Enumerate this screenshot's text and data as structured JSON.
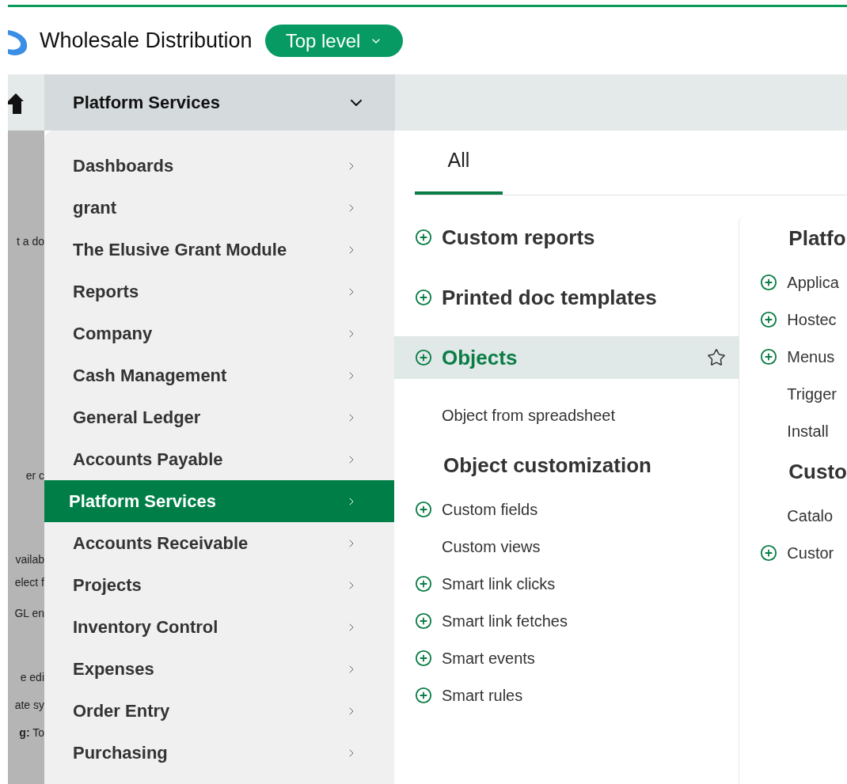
{
  "header": {
    "title": "Wholesale Distribution",
    "level_button": "Top level"
  },
  "nav": {
    "current": "Platform Services"
  },
  "background_fragments": [
    "t a do",
    "er c",
    "vailab",
    "elect f",
    "GL en",
    "e edi",
    "ate sy",
    "**g:** To"
  ],
  "menu": [
    {
      "label": "Dashboards",
      "selected": false
    },
    {
      "label": "grant",
      "selected": false
    },
    {
      "label": "The Elusive Grant Module",
      "selected": false
    },
    {
      "label": "Reports",
      "selected": false
    },
    {
      "label": "Company",
      "selected": false
    },
    {
      "label": "Cash Management",
      "selected": false
    },
    {
      "label": "General Ledger",
      "selected": false
    },
    {
      "label": "Accounts Payable",
      "selected": false
    },
    {
      "label": "Platform Services",
      "selected": true
    },
    {
      "label": "Accounts Receivable",
      "selected": false
    },
    {
      "label": "Projects",
      "selected": false
    },
    {
      "label": "Inventory Control",
      "selected": false
    },
    {
      "label": "Expenses",
      "selected": false
    },
    {
      "label": "Order Entry",
      "selected": false
    },
    {
      "label": "Purchasing",
      "selected": false
    }
  ],
  "tabs": [
    {
      "label": "All",
      "selected": true
    }
  ],
  "columns": [
    [
      {
        "kind": "group",
        "label": "Custom reports",
        "plus": true,
        "selected": false
      },
      {
        "kind": "group",
        "label": "Printed doc templates",
        "plus": true,
        "selected": false
      },
      {
        "kind": "group",
        "label": "Objects",
        "plus": true,
        "selected": true
      },
      {
        "kind": "link",
        "label": "Object from spreadsheet",
        "plus": false
      },
      {
        "kind": "heading",
        "label": "Object customization"
      },
      {
        "kind": "link",
        "label": "Custom fields",
        "plus": true
      },
      {
        "kind": "link",
        "label": "Custom views",
        "plus": false
      },
      {
        "kind": "link",
        "label": "Smart link clicks",
        "plus": true
      },
      {
        "kind": "link",
        "label": "Smart link fetches",
        "plus": true
      },
      {
        "kind": "link",
        "label": "Smart events",
        "plus": true
      },
      {
        "kind": "link",
        "label": "Smart rules",
        "plus": true
      }
    ],
    [
      {
        "kind": "heading",
        "label": "Platfo"
      },
      {
        "kind": "link",
        "label": "Applica",
        "plus": true
      },
      {
        "kind": "link",
        "label": "Hostec",
        "plus": true
      },
      {
        "kind": "link",
        "label": "Menus",
        "plus": true
      },
      {
        "kind": "link",
        "label": "Trigger",
        "plus": false
      },
      {
        "kind": "link",
        "label": "Install",
        "plus": false
      },
      {
        "kind": "heading",
        "label": "Custo"
      },
      {
        "kind": "link",
        "label": "Catalo",
        "plus": false
      },
      {
        "kind": "link",
        "label": "Custor",
        "plus": true
      }
    ]
  ]
}
